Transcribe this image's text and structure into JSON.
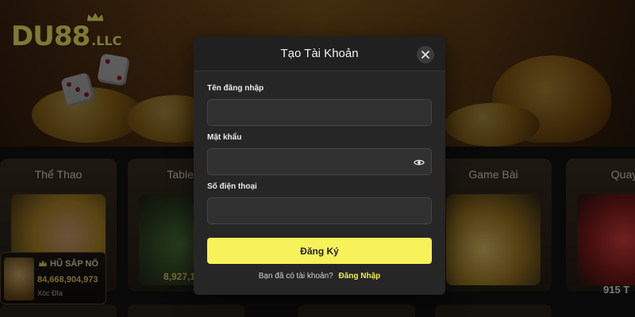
{
  "brand": {
    "logo_main": "DU88",
    "logo_suffix": ".LLC",
    "accent": "#f7f15a"
  },
  "categories": [
    {
      "title": "Thể Thao"
    },
    {
      "title": "Table G"
    },
    {
      "title": ""
    },
    {
      "title": "Game Bài"
    },
    {
      "title": "Quay"
    }
  ],
  "jackpot": {
    "title": "HŨ SẮP NỔ",
    "amount": "84,668,904,973",
    "game": "Xóc Đĩa"
  },
  "card_amount": "8,927,1",
  "card_side_text": "915 T",
  "modal": {
    "title": "Tạo Tài Khoản",
    "close_icon": "close-icon",
    "fields": {
      "username": {
        "label": "Tên đăng nhập",
        "value": "",
        "placeholder": ""
      },
      "password": {
        "label": "Mật khẩu",
        "value": "",
        "placeholder": "",
        "icon": "eye-icon"
      },
      "phone": {
        "label": "Số điện thoại",
        "value": "",
        "placeholder": ""
      }
    },
    "submit_label": "Đăng Ký",
    "footer_text": "Bạn đã có tài khoản?",
    "footer_link": "Đăng Nhập"
  }
}
